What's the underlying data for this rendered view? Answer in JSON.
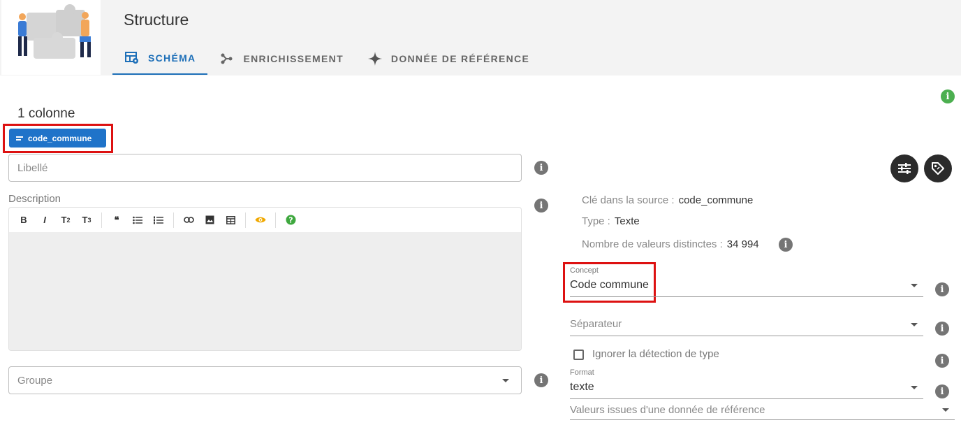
{
  "header": {
    "title": "Structure",
    "tabs": [
      {
        "label": "SCHÉMA",
        "icon": "table-cog-icon",
        "active": true
      },
      {
        "label": "ENRICHISSEMENT",
        "icon": "graph-nodes-icon",
        "active": false
      },
      {
        "label": "DONNÉE DE RÉFÉRENCE",
        "icon": "sparkle-icon",
        "active": false
      }
    ]
  },
  "colors": {
    "accent": "#1d6fb8",
    "chip": "#1f73c9",
    "highlight": "#dd1111",
    "info_green": "#4caf50"
  },
  "columns": {
    "count_label": "1 colonne",
    "chip_label": "code_commune"
  },
  "form": {
    "libelle_placeholder": "Libellé",
    "description_label": "Description",
    "groupe_placeholder": "Groupe",
    "toolbar": [
      "B",
      "I",
      "T",
      "2",
      "T",
      "3",
      "❝",
      "bullet-list-icon",
      "numbered-list-icon",
      "link-icon",
      "image-icon",
      "table-icon",
      "eye-icon",
      "help-icon"
    ]
  },
  "details": {
    "source_key_label": "Clé dans la source :",
    "source_key_value": "code_commune",
    "type_label": "Type :",
    "type_value": "Texte",
    "distinct_label": "Nombre de valeurs distinctes :",
    "distinct_value": "34 994",
    "concept_label": "Concept",
    "concept_value": "Code commune",
    "separator_placeholder": "Séparateur",
    "ignore_type_label": "Ignorer la détection de type",
    "format_label": "Format",
    "format_value": "texte",
    "ref_values_placeholder": "Valeurs issues d'une donnée de référence"
  }
}
